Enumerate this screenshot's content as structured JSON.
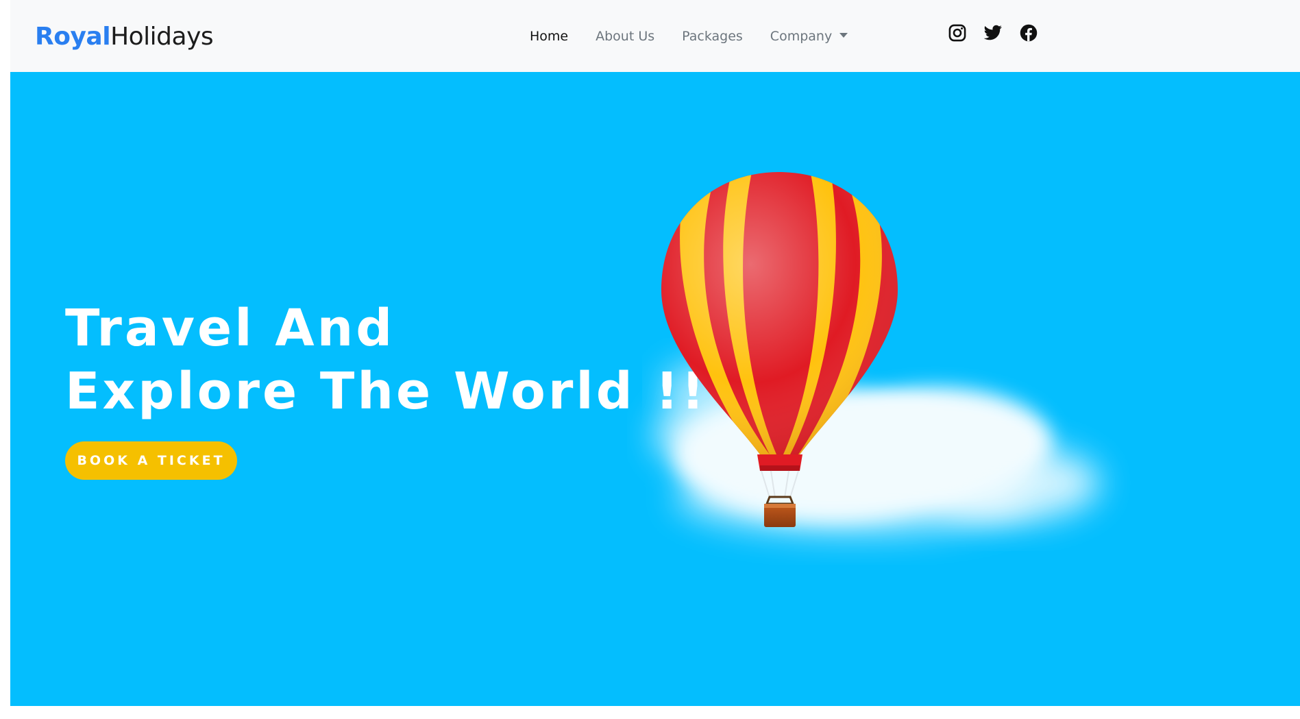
{
  "brand": {
    "part1": "Royal",
    "part2": "Holidays"
  },
  "nav": {
    "items": [
      {
        "label": "Home",
        "active": true
      },
      {
        "label": "About Us",
        "active": false
      },
      {
        "label": "Packages",
        "active": false
      },
      {
        "label": "Company",
        "active": false,
        "dropdown": true
      }
    ]
  },
  "social": {
    "icons": [
      "instagram-icon",
      "twitter-icon",
      "facebook-icon"
    ]
  },
  "hero": {
    "headline_line1": "Travel And",
    "headline_line2": "Explore The World !!",
    "cta_label": "BOOK A TICKET",
    "image": "hot-air-balloon-over-cloud"
  },
  "colors": {
    "brand_blue": "#2a7ff0",
    "hero_bg": "#04befe",
    "cta_bg": "#f5c000",
    "navbar_bg": "#f8f9fa",
    "balloon_red": "#e01b24",
    "balloon_yellow": "#ffc20e"
  }
}
